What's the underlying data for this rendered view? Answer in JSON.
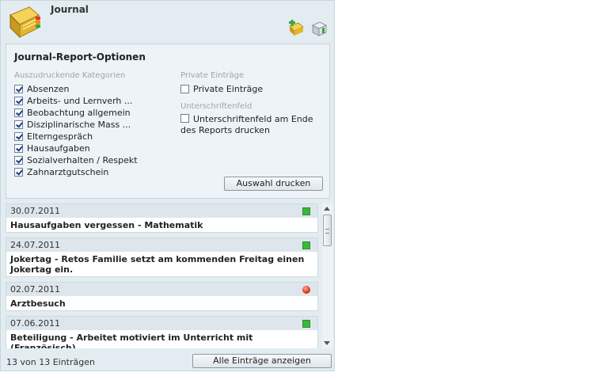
{
  "header": {
    "title": "Journal",
    "icons": {
      "app": "journal-book-icon",
      "add": "add-entry-icon",
      "print": "print-icon"
    }
  },
  "options": {
    "heading": "Journal-Report-Optionen",
    "categories_label": "Auszudruckende Kategorien",
    "categories": [
      {
        "label": "Absenzen",
        "checked": true
      },
      {
        "label": "Arbeits- und Lernverh ...",
        "checked": true
      },
      {
        "label": "Beobachtung allgemein",
        "checked": true
      },
      {
        "label": "Disziplinarische Mass ...",
        "checked": true
      },
      {
        "label": "Elterngespräch",
        "checked": true
      },
      {
        "label": "Hausaufgaben",
        "checked": true
      },
      {
        "label": "Sozialverhalten / Respekt",
        "checked": true
      },
      {
        "label": "Zahnarztgutschein",
        "checked": true
      }
    ],
    "private_label": "Private Einträge",
    "private_checkbox": {
      "label": "Private Einträge",
      "checked": false
    },
    "signature_label": "Unterschriftenfeld",
    "signature_checkbox": {
      "label": "Unterschriftenfeld am Ende des Reports drucken",
      "checked": false
    },
    "print_button": "Auswahl drucken"
  },
  "entries": [
    {
      "date": "30.07.2011",
      "text": "Hausaufgaben vergessen - Mathematik",
      "status": "green"
    },
    {
      "date": "24.07.2011",
      "text": "Jokertag - Retos Familie setzt am kommenden Freitag einen Jokertag ein.",
      "status": "green"
    },
    {
      "date": "02.07.2011",
      "text": "Arztbesuch",
      "status": "red"
    },
    {
      "date": "07.06.2011",
      "text": "Beteiligung - Arbeitet motiviert im Unterricht mit (Französisch)",
      "status": "green"
    }
  ],
  "footer": {
    "count": "13 von 13 Einträgen",
    "show_all_button": "Alle Einträge anzeigen"
  },
  "colors": {
    "green_status": "#3ab83a",
    "red_status": "#e0301a",
    "panel_bg": "#e3ecf1"
  }
}
